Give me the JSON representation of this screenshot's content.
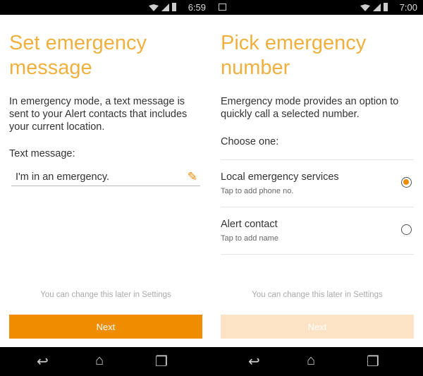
{
  "screen1": {
    "status_time": "6:59",
    "title_line1": "Set emergency",
    "title_line2": "message",
    "description": "In emergency mode, a text message is sent to your Alert contacts that includes your current location.",
    "field_label": "Text message:",
    "field_value": "I'm in an emergency.",
    "note": "You can change this later in Settings",
    "next_label": "Next",
    "next_enabled": true
  },
  "screen2": {
    "status_time": "7:00",
    "title_line1": "Pick emergency",
    "title_line2": "number",
    "description": "Emergency mode provides an option to quickly call a selected number.",
    "choose_label": "Choose one:",
    "options": [
      {
        "title": "Local emergency services",
        "subtitle": "Tap to add phone no.",
        "selected": true
      },
      {
        "title": "Alert contact",
        "subtitle": "Tap to add name",
        "selected": false
      }
    ],
    "note": "You can change this later in Settings",
    "next_label": "Next",
    "next_enabled": false
  },
  "colors": {
    "accent": "#f08c00",
    "title": "#f0b040",
    "disabled_button": "#fde3c6"
  },
  "icons": [
    "wifi-icon",
    "signal-icon",
    "battery-icon",
    "image-notification-icon",
    "pencil-icon",
    "back-icon",
    "home-icon",
    "recents-icon"
  ]
}
